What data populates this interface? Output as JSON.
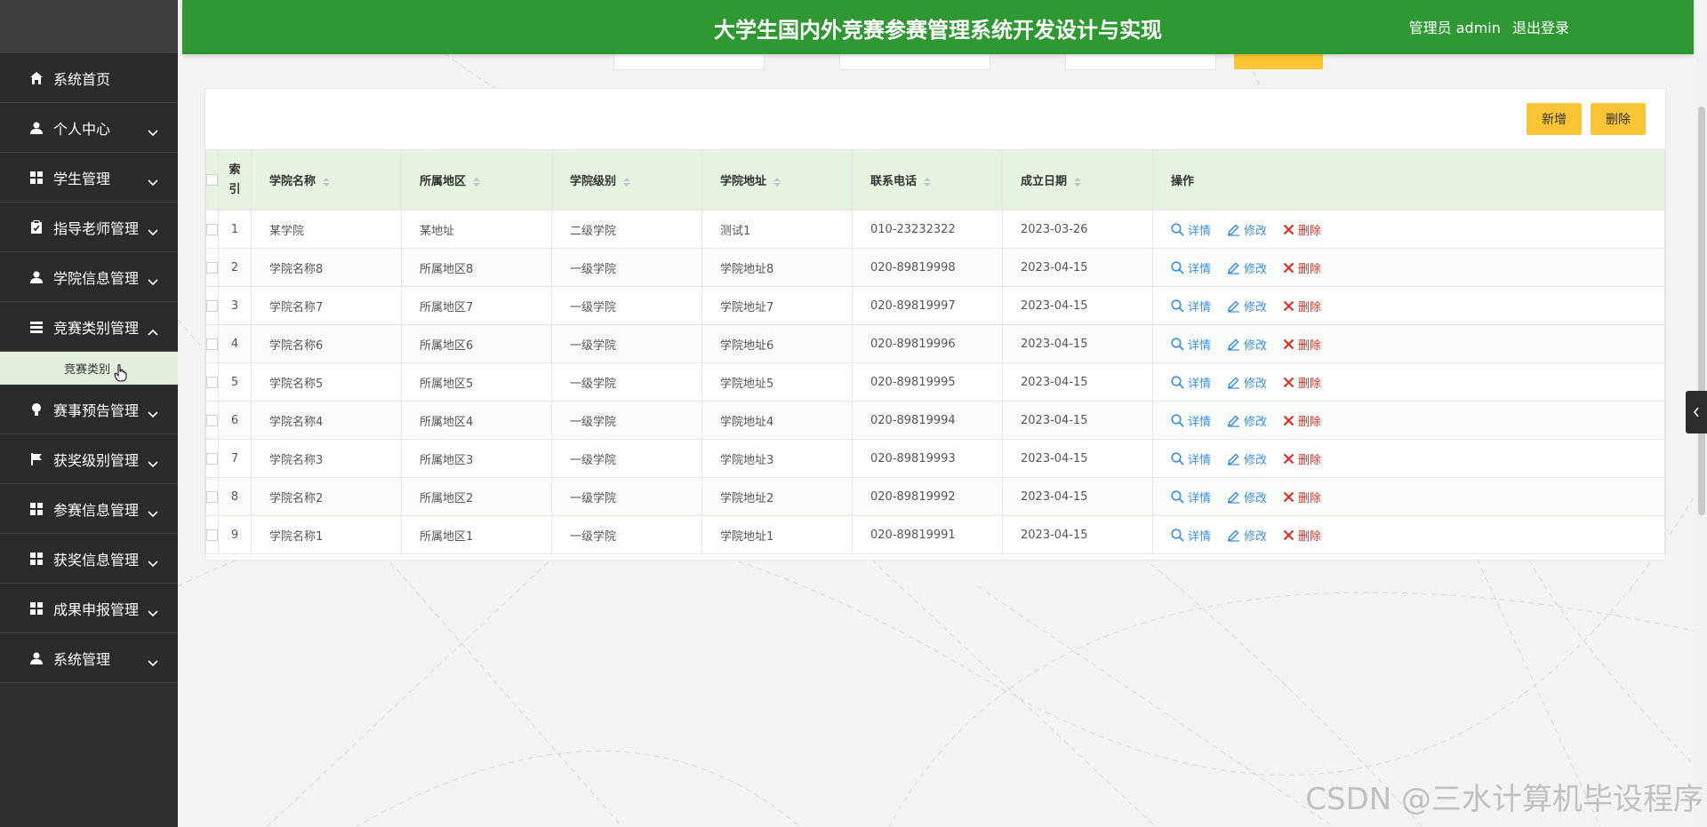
{
  "header": {
    "title": "大学生国内外竞赛参赛管理系统开发设计与实现",
    "user_label": "管理员 admin",
    "logout": "退出登录"
  },
  "sidebar": {
    "items": [
      {
        "label": "系统首页",
        "icon": "home-icon"
      },
      {
        "label": "个人中心",
        "icon": "user-icon"
      },
      {
        "label": "学生管理",
        "icon": "grid-icon"
      },
      {
        "label": "指导老师管理",
        "icon": "clipboard-icon"
      },
      {
        "label": "学院信息管理",
        "icon": "user-icon"
      },
      {
        "label": "竞赛类别管理",
        "icon": "list-icon",
        "expanded": true
      },
      {
        "label": "赛事预告管理",
        "icon": "bulb-icon"
      },
      {
        "label": "获奖级别管理",
        "icon": "flag-icon"
      },
      {
        "label": "参赛信息管理",
        "icon": "grid-icon"
      },
      {
        "label": "获奖信息管理",
        "icon": "grid-icon"
      },
      {
        "label": "成果申报管理",
        "icon": "grid-icon"
      },
      {
        "label": "系统管理",
        "icon": "user-icon"
      }
    ],
    "submenu": {
      "label": "竞赛类别"
    }
  },
  "toolbar": {
    "add_label": "新增",
    "delete_label": "删除"
  },
  "table": {
    "headers": {
      "index": "索引",
      "name": "学院名称",
      "region": "所属地区",
      "level": "学院级别",
      "address": "学院地址",
      "phone": "联系电话",
      "date": "成立日期",
      "actions": "操作"
    },
    "actions": {
      "detail": "详情",
      "edit": "修改",
      "delete": "删除"
    },
    "rows": [
      {
        "idx": "1",
        "name": "某学院",
        "region": "某地址",
        "level": "二级学院",
        "address": "测试1",
        "phone": "010-23232322",
        "date": "2023-03-26"
      },
      {
        "idx": "2",
        "name": "学院名称8",
        "region": "所属地区8",
        "level": "一级学院",
        "address": "学院地址8",
        "phone": "020-89819998",
        "date": "2023-04-15"
      },
      {
        "idx": "3",
        "name": "学院名称7",
        "region": "所属地区7",
        "level": "一级学院",
        "address": "学院地址7",
        "phone": "020-89819997",
        "date": "2023-04-15"
      },
      {
        "idx": "4",
        "name": "学院名称6",
        "region": "所属地区6",
        "level": "一级学院",
        "address": "学院地址6",
        "phone": "020-89819996",
        "date": "2023-04-15"
      },
      {
        "idx": "5",
        "name": "学院名称5",
        "region": "所属地区5",
        "level": "一级学院",
        "address": "学院地址5",
        "phone": "020-89819995",
        "date": "2023-04-15"
      },
      {
        "idx": "6",
        "name": "学院名称4",
        "region": "所属地区4",
        "level": "一级学院",
        "address": "学院地址4",
        "phone": "020-89819994",
        "date": "2023-04-15"
      },
      {
        "idx": "7",
        "name": "学院名称3",
        "region": "所属地区3",
        "level": "一级学院",
        "address": "学院地址3",
        "phone": "020-89819993",
        "date": "2023-04-15"
      },
      {
        "idx": "8",
        "name": "学院名称2",
        "region": "所属地区2",
        "level": "一级学院",
        "address": "学院地址2",
        "phone": "020-89819992",
        "date": "2023-04-15"
      },
      {
        "idx": "9",
        "name": "学院名称1",
        "region": "所属地区1",
        "level": "一级学院",
        "address": "学院地址1",
        "phone": "020-89819991",
        "date": "2023-04-15"
      }
    ]
  },
  "watermark": "CSDN @三水计算机毕设程序",
  "colors": {
    "header_green": "#2f9833",
    "button_yellow": "#f8c534",
    "link_blue": "#3a8ee6",
    "delete_red": "#d9312a"
  }
}
